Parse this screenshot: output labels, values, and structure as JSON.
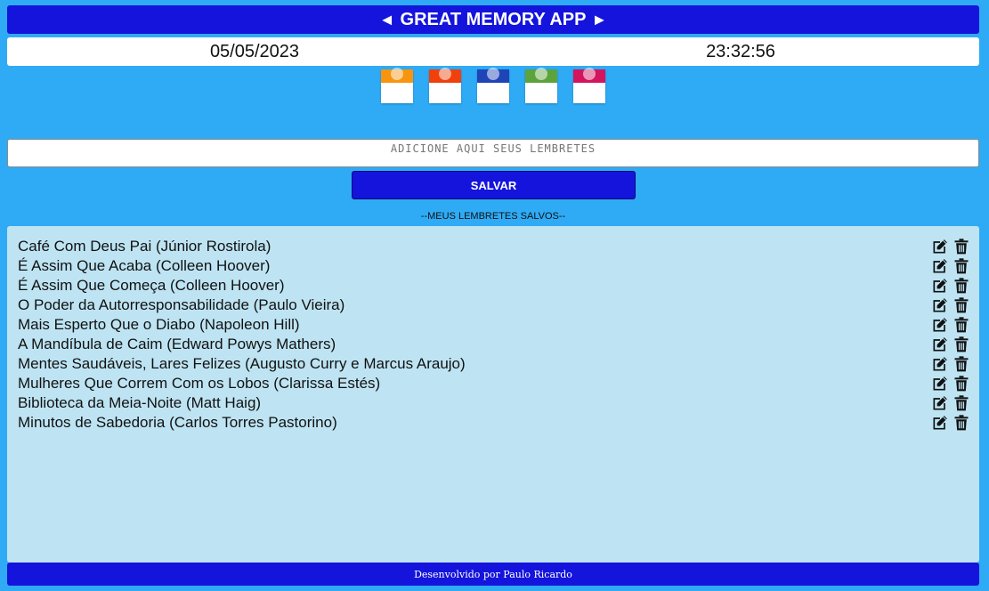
{
  "header": {
    "title": "GREAT MEMORY APP",
    "prev_arrow": "◄",
    "next_arrow": "►"
  },
  "datetime": {
    "date": "05/05/2023",
    "time": "23:32:56"
  },
  "themes": [
    {
      "name": "orange",
      "color": "#f7950f"
    },
    {
      "name": "red",
      "color": "#f0400b"
    },
    {
      "name": "blue",
      "color": "#1e44b8"
    },
    {
      "name": "green",
      "color": "#5da33c"
    },
    {
      "name": "pink",
      "color": "#d3145e"
    }
  ],
  "input": {
    "placeholder": "ADICIONE AQUI SEUS LEMBRETES",
    "value": ""
  },
  "save_button": {
    "label": "SALVAR"
  },
  "saved_title": "--MEUS LEMBRETES SALVOS--",
  "reminders": [
    "Café Com Deus Pai (Júnior Rostirola)",
    "É Assim Que Acaba (Colleen Hoover)",
    "É Assim Que Começa (Colleen Hoover)",
    "O Poder da Autorresponsabilidade (Paulo Vieira)",
    "Mais Esperto Que o Diabo (Napoleon Hill)",
    "A Mandíbula de Caim (Edward Powys Mathers)",
    "Mentes Saudáveis, Lares Felizes (Augusto Curry e Marcus Araujo)",
    "Mulheres Que Correm Com os Lobos (Clarissa Estés)",
    "Biblioteca da Meia-Noite (Matt Haig)",
    "Minutos de Sabedoria (Carlos Torres Pastorino)"
  ],
  "icons": {
    "edit": "edit-icon",
    "delete": "trash-icon"
  },
  "footer": {
    "text": "Desenvolvido por Paulo Ricardo"
  }
}
